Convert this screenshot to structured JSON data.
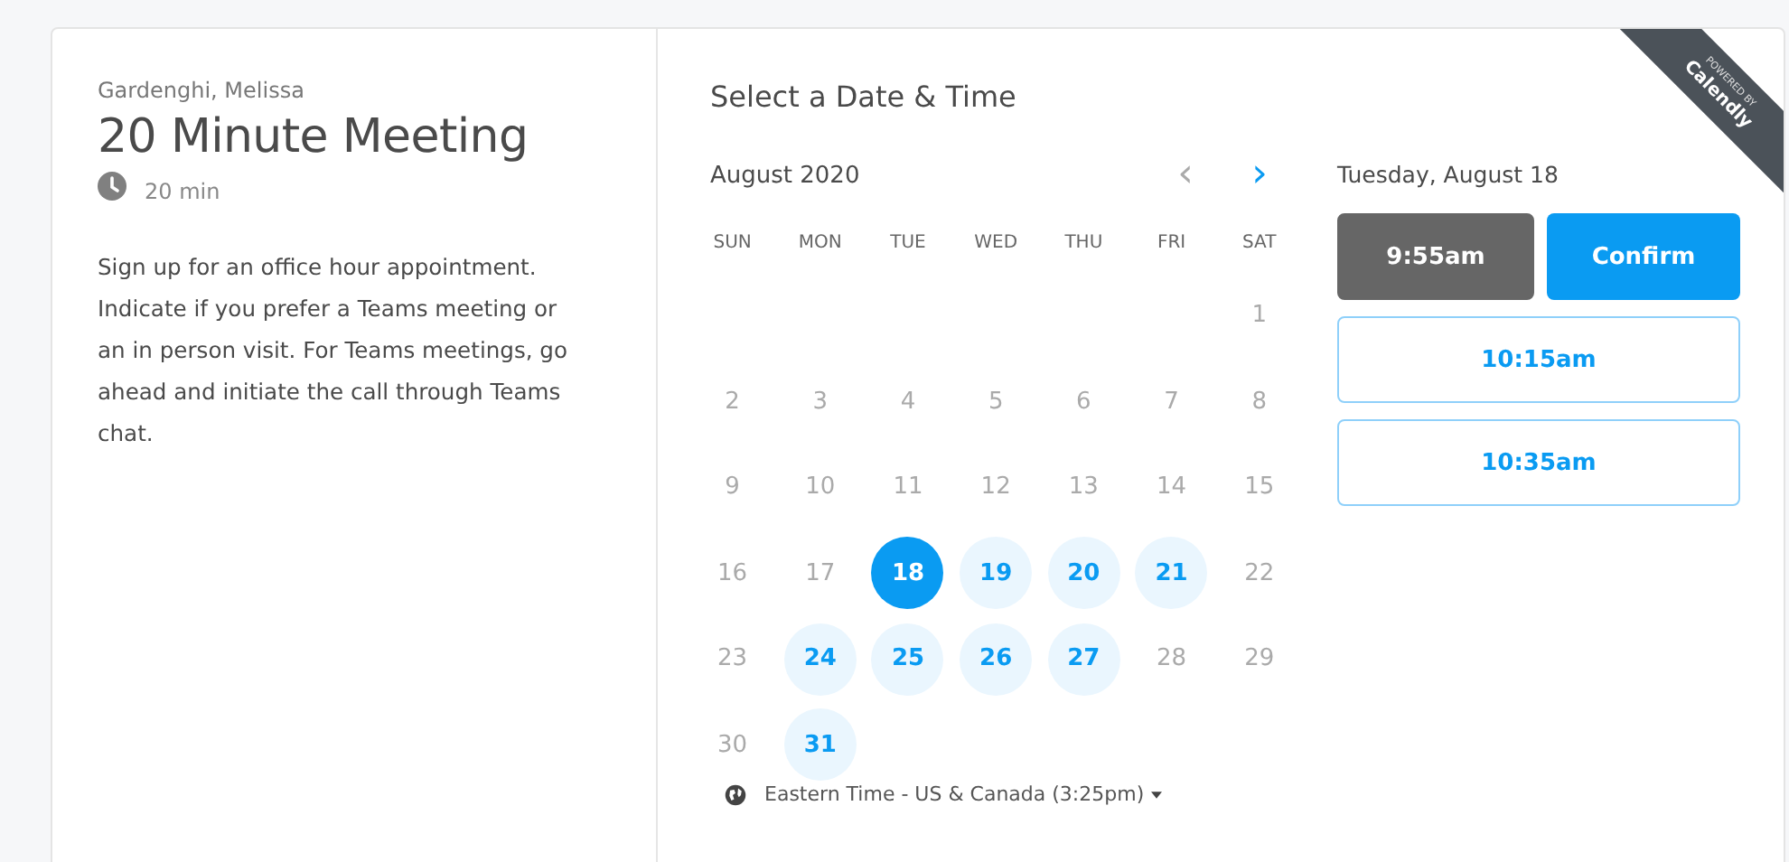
{
  "organizer": "Gardenghi, Melissa",
  "event": {
    "title": "20 Minute Meeting",
    "duration": "20 min",
    "description": "Sign up for an office hour appointment. Indicate if you prefer a Teams meeting or an in person visit. For Teams meetings, go ahead and initiate the call through Teams chat."
  },
  "heading": "Select a Date & Time",
  "calendar": {
    "month": "August 2020",
    "prev": {
      "label": "‹",
      "disabled": true
    },
    "next": {
      "label": "›",
      "disabled": false
    },
    "weekdays": [
      "SUN",
      "MON",
      "TUE",
      "WED",
      "THU",
      "FRI",
      "SAT"
    ],
    "weeks": [
      [
        {
          "day": "1",
          "kind": "plain"
        }
      ],
      [
        {
          "day": "2",
          "kind": "plain"
        },
        {
          "day": "3",
          "kind": "plain"
        },
        {
          "day": "4",
          "kind": "plain"
        },
        {
          "day": "5",
          "kind": "plain"
        },
        {
          "day": "6",
          "kind": "plain"
        },
        {
          "day": "7",
          "kind": "plain"
        },
        {
          "day": "8",
          "kind": "plain"
        }
      ],
      [
        {
          "day": "9",
          "kind": "plain"
        },
        {
          "day": "10",
          "kind": "plain"
        },
        {
          "day": "11",
          "kind": "plain"
        },
        {
          "day": "12",
          "kind": "plain"
        },
        {
          "day": "13",
          "kind": "plain"
        },
        {
          "day": "14",
          "kind": "plain"
        },
        {
          "day": "15",
          "kind": "plain"
        }
      ],
      [
        {
          "day": "16",
          "kind": "plain"
        },
        {
          "day": "17",
          "kind": "plain"
        },
        {
          "day": "18",
          "kind": "selected"
        },
        {
          "day": "19",
          "kind": "available"
        },
        {
          "day": "20",
          "kind": "available"
        },
        {
          "day": "21",
          "kind": "available"
        },
        {
          "day": "22",
          "kind": "plain"
        }
      ],
      [
        {
          "day": "23",
          "kind": "plain"
        },
        {
          "day": "24",
          "kind": "available"
        },
        {
          "day": "25",
          "kind": "available"
        },
        {
          "day": "26",
          "kind": "available"
        },
        {
          "day": "27",
          "kind": "available"
        },
        {
          "day": "28",
          "kind": "plain"
        },
        {
          "day": "29",
          "kind": "plain"
        }
      ],
      [
        {
          "day": "30",
          "kind": "plain"
        },
        {
          "day": "31",
          "kind": "available"
        }
      ]
    ]
  },
  "timezone": "Eastern Time - US & Canada (3:25pm)",
  "selected_date": "Tuesday, August 18",
  "slots": [
    {
      "time": "9:55am",
      "selected": true
    },
    {
      "time": "10:15am",
      "selected": false
    },
    {
      "time": "10:35am",
      "selected": false
    }
  ],
  "confirm_label": "Confirm",
  "ribbon": {
    "top": "POWERED BY",
    "bottom": "Calendly"
  }
}
